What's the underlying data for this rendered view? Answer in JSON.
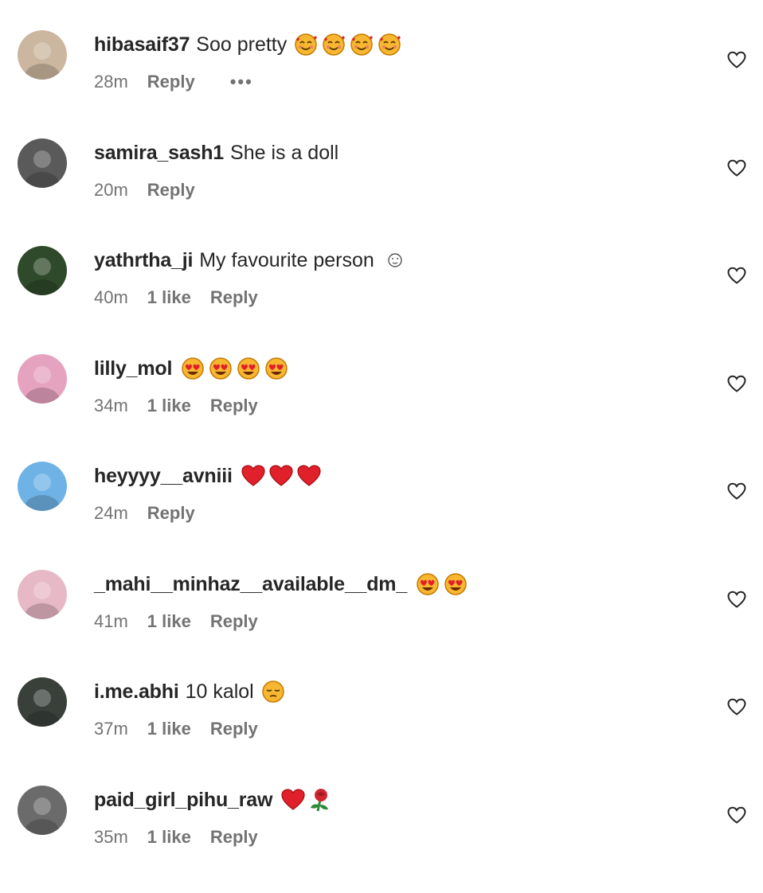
{
  "comments": [
    {
      "username": "hibasaif37",
      "text": "Soo pretty",
      "emojis": [
        "smiling-hearts-emoji",
        "smiling-hearts-emoji",
        "smiling-hearts-emoji",
        "smiling-hearts-emoji"
      ],
      "time": "28m",
      "likes": "",
      "reply": "Reply",
      "more": "•••",
      "avatar_color": "#cbb79f"
    },
    {
      "username": "samira_sash1",
      "text": "She is a doll",
      "emojis": [],
      "time": "20m",
      "likes": "",
      "reply": "Reply",
      "avatar_color": "#5a5a5a"
    },
    {
      "username": "yathrtha_ji",
      "text": "My favourite person",
      "emojis": [
        "small-face-emoji"
      ],
      "time": "40m",
      "likes": "1 like",
      "reply": "Reply",
      "avatar_color": "#2f4a2a"
    },
    {
      "username": "lilly_mol",
      "text": "",
      "emojis": [
        "heart-eyes-emoji",
        "heart-eyes-emoji",
        "heart-eyes-emoji",
        "heart-eyes-emoji"
      ],
      "time": "34m",
      "likes": "1 like",
      "reply": "Reply",
      "avatar_color": "#e6a3c0"
    },
    {
      "username": "heyyyy__avniii",
      "text": "",
      "emojis": [
        "red-heart-emoji",
        "red-heart-emoji",
        "red-heart-emoji"
      ],
      "time": "24m",
      "likes": "",
      "reply": "Reply",
      "avatar_color": "#6fb3e6"
    },
    {
      "username": "_mahi__minhaz__available__dm_",
      "text": "",
      "emojis": [
        "heart-eyes-emoji",
        "heart-eyes-emoji"
      ],
      "time": "41m",
      "likes": "1 like",
      "reply": "Reply",
      "avatar_color": "#e7b8c6"
    },
    {
      "username": "i.me.abhi",
      "text": "10 kalol",
      "emojis": [
        "pensive-face-emoji"
      ],
      "time": "37m",
      "likes": "1 like",
      "reply": "Reply",
      "avatar_color": "#39403a"
    },
    {
      "username": "paid_girl_pihu_raw",
      "text": "",
      "emojis": [
        "red-heart-emoji",
        "rose-emoji"
      ],
      "time": "35m",
      "likes": "1 like",
      "reply": "Reply",
      "avatar_color": "#6b6b6b"
    }
  ],
  "icons": {
    "like": "heart-outline-icon",
    "more": "more-options-icon"
  },
  "colors": {
    "text": "#262626",
    "secondary": "#737373",
    "emoji_yellow": "#f4b400",
    "heart_red": "#e0202a"
  }
}
